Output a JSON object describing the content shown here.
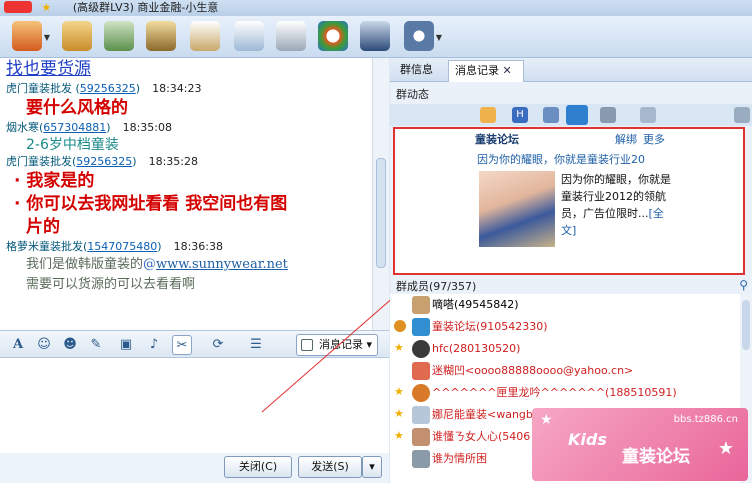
{
  "title": {
    "app": "(高级群LV3) 商业金融-小生意"
  },
  "chat": {
    "messages": [
      {
        "text": "找也要货源"
      },
      {
        "sender": "虎门童装批发",
        "qq": "59256325",
        "time": "18:34:23",
        "text": "要什么风格的"
      },
      {
        "sender": "烟水寒",
        "qq": "657304881",
        "time": "18:35:08",
        "text": "2-6岁中档童装"
      },
      {
        "sender": "虎门童装批发",
        "qq": "59256325",
        "time": "18:35:28",
        "text1": "我家是的",
        "text2": "你可以去我网址看看   我空间也有图",
        "text3": "片的"
      },
      {
        "sender": "格萝米童装批发",
        "qq": "1547075480",
        "time": "18:36:38",
        "text1": "我们是做韩版童装的",
        "url": "www.sunnywear.net",
        "text2": "需要可以货源的可以去看看啊"
      }
    ]
  },
  "toolbar": {
    "history_label": "消息记录"
  },
  "bottom": {
    "close_label": "关闭(C)",
    "send_label": "发送(S)"
  },
  "right": {
    "tab_info": "群信息",
    "tab_history": "消息记录",
    "dynamics_label": "群动态",
    "dyn": {
      "title": "童装论坛",
      "unbind": "解绑",
      "more": "更多",
      "subtitle": "因为你的耀眼，你就是童装行业20",
      "body": "因为你的耀眼，你就是童装行业2012的领航员，广告位限时...",
      "fulltext": "[全文]"
    },
    "members_label": "群成员(97/357)",
    "members": [
      {
        "name": "嘀嗒(49545842)"
      },
      {
        "name": "童装论坛(910542330)"
      },
      {
        "name": "hfc(280130520)"
      },
      {
        "name": "迷糊凹<oooo88888oooo@yahoo.cn>"
      },
      {
        "name": "^^^^^^^匣里龙吟^^^^^^^(188510591)"
      },
      {
        "name": "娜尼能童装<wangb"
      },
      {
        "name": "谁懂ㄋ女人心(5406"
      },
      {
        "name": "谁为情所困"
      }
    ]
  },
  "ad": {
    "url": "bbs.tz886.cn",
    "kids": "Kids",
    "cn": "童装论坛"
  },
  "colors": {
    "accent": "#d40000",
    "link": "#1d5fa6",
    "highlight_border": "#e0332f"
  }
}
